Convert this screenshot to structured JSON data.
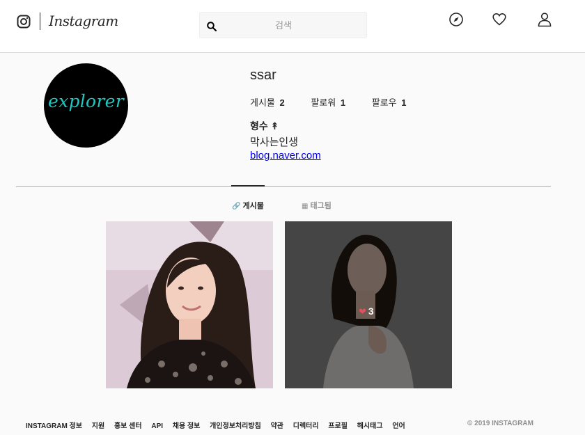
{
  "header": {
    "wordmark": "Instagram",
    "search_placeholder": "검색",
    "icons": [
      "instagram-logo-icon",
      "search-icon",
      "compass-icon",
      "heart-icon",
      "user-icon"
    ]
  },
  "profile": {
    "username": "ssar",
    "avatar_text": "explorer",
    "stats": {
      "posts_label": "게시물",
      "posts_count": "2",
      "followers_label": "팔로워",
      "followers_count": "1",
      "following_label": "팔로우",
      "following_count": "1"
    },
    "full_name": "형수 ↟",
    "bio": "막사는인생",
    "link": "blog.naver.com"
  },
  "tabs": {
    "posts_label": "게시물",
    "tagged_label": "태그됨",
    "active": "posts"
  },
  "posts": [
    {
      "likes": null
    },
    {
      "likes": "3"
    }
  ],
  "footer": {
    "links": [
      "INSTAGRAM 정보",
      "지원",
      "홍보 센터",
      "API",
      "채용 정보",
      "개인정보처리방침",
      "약관",
      "디렉터리",
      "프로필",
      "해시태그",
      "언어"
    ],
    "copyright": "© 2019 INSTAGRAM"
  },
  "colors": {
    "link": "#0000ee",
    "avatar_text": "#1fc7c1",
    "heart": "#e0525d"
  }
}
